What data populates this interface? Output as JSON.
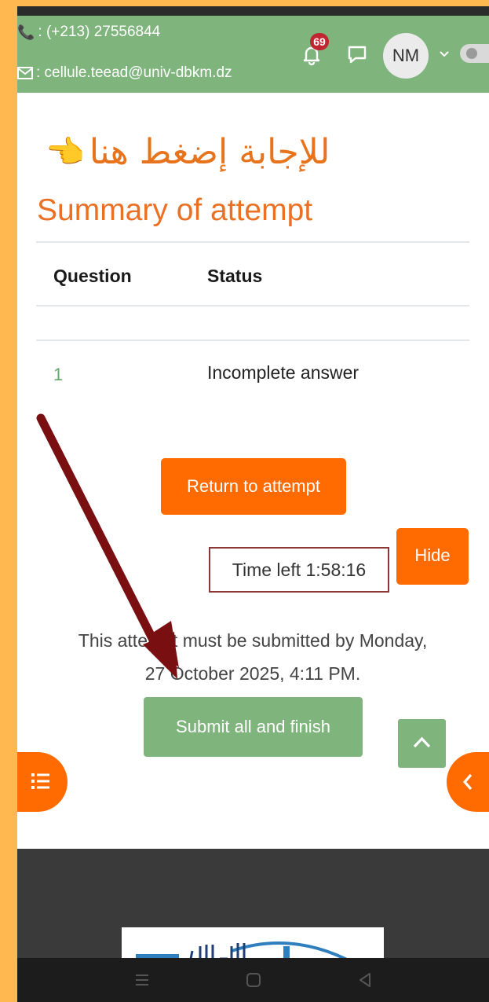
{
  "header": {
    "phone": ": (+213) 27556844",
    "email": ": cellule.teead@univ-dbkm.dz",
    "notification_count": "69",
    "avatar_initials": "NM"
  },
  "banner": {
    "arabic_text": "للإجابة إضغط هنا",
    "hand_icon": "👈"
  },
  "page": {
    "title": "Summary of attempt"
  },
  "table": {
    "headers": [
      "Question",
      "Status"
    ],
    "rows": [
      {
        "question": "1",
        "status": "Incomplete answer"
      }
    ]
  },
  "actions": {
    "return_label": "Return to attempt",
    "hide_label": "Hide",
    "time_left": "Time left 1:58:16",
    "deadline_line1": "This attempt must be submitted by Monday,",
    "deadline_line2": "27 October 2025, 4:11 PM.",
    "submit_label": "Submit all and finish"
  },
  "colors": {
    "header_bg": "#7fb57d",
    "accent_orange": "#ff6b00",
    "title_orange": "#ea7024",
    "timer_border": "#8d3636",
    "arrow": "#7a0f12",
    "page_border": "#FFB850"
  },
  "icons": [
    "phone-icon",
    "mail-icon",
    "bell-icon",
    "chat-icon",
    "chevron-down-icon",
    "chevron-up-icon",
    "list-icon",
    "chevron-left-icon",
    "menu-nav-icon",
    "home-nav-icon",
    "back-nav-icon",
    "arrow-pointer"
  ]
}
